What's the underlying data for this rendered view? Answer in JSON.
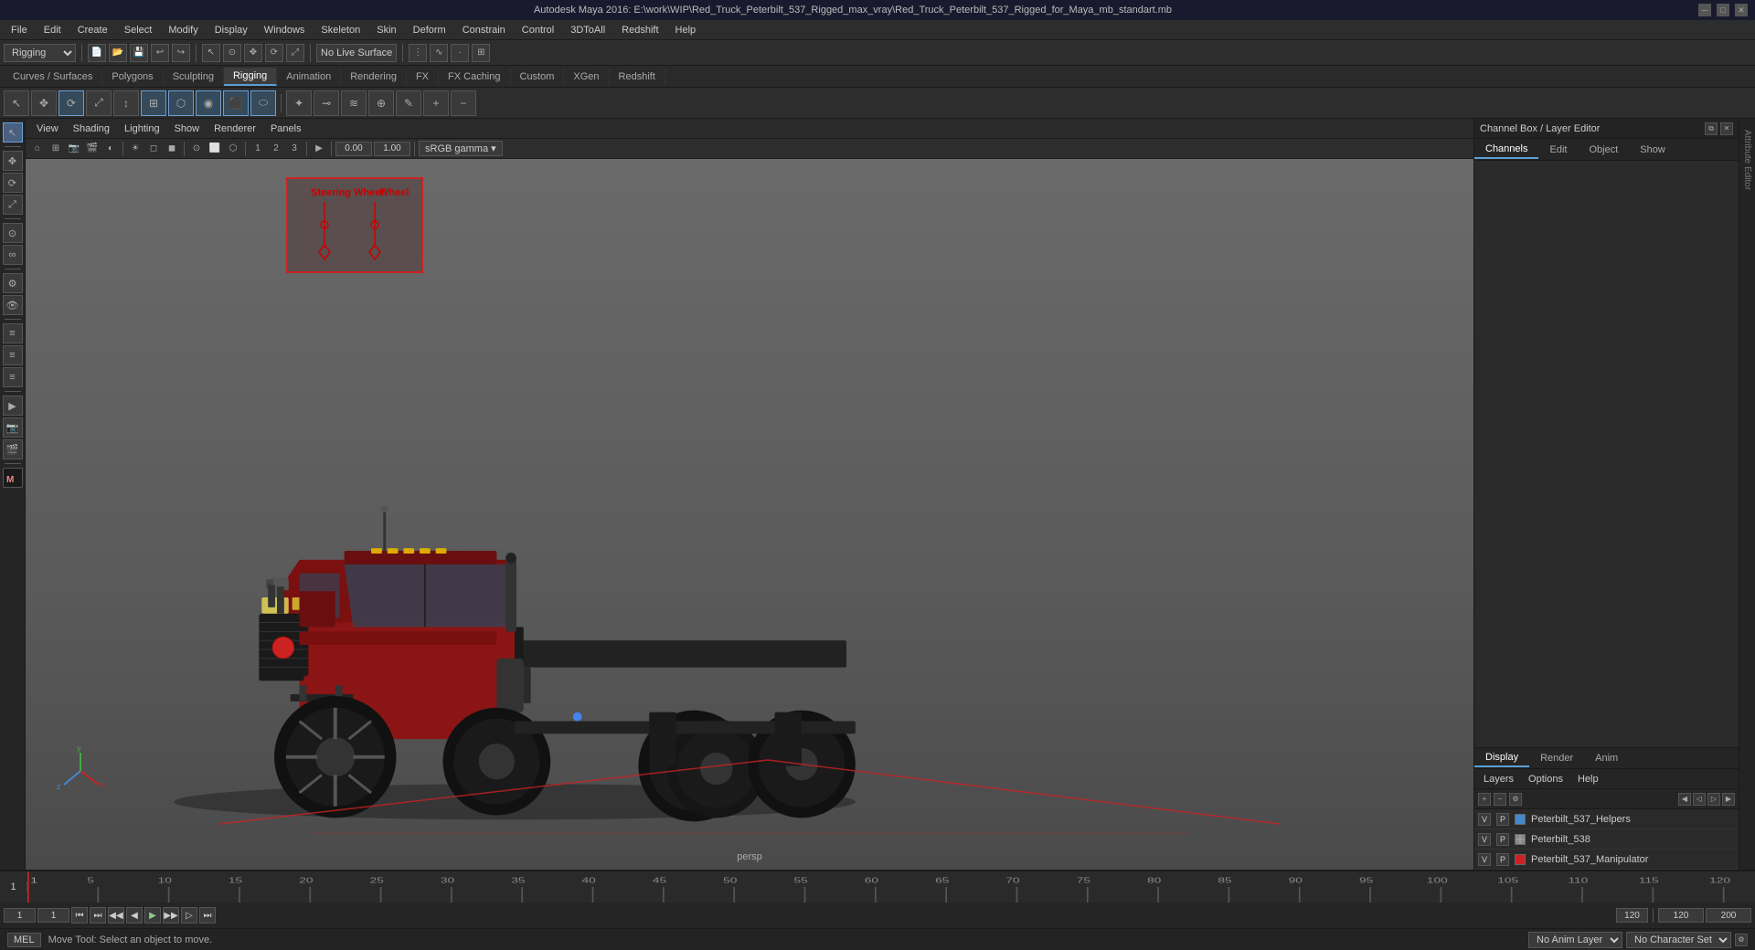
{
  "window": {
    "title": "Autodesk Maya 2016: E:\\work\\WIP\\Red_Truck_Peterbilt_537_Rigged_max_vray\\Red_Truck_Peterbilt_537_Rigged_for_Maya_mb_standart.mb"
  },
  "menubar": {
    "items": [
      "File",
      "Edit",
      "Create",
      "Select",
      "Modify",
      "Display",
      "Windows",
      "Skeleton",
      "Skin",
      "Deform",
      "Constrain",
      "Control",
      "3DToAll",
      "Redshift",
      "Help"
    ]
  },
  "toolbar1": {
    "workspace_dropdown": "Rigging",
    "live_surface_label": "No Live Surface"
  },
  "shelf_tabs": {
    "items": [
      "Curves / Surfaces",
      "Polygons",
      "Sculpting",
      "Rigging",
      "Animation",
      "Rendering",
      "FX",
      "FX Caching",
      "Custom",
      "XGen",
      "Redshift"
    ],
    "active": "Rigging"
  },
  "viewport_menu": {
    "items": [
      "View",
      "Shading",
      "Lighting",
      "Show",
      "Renderer",
      "Panels"
    ]
  },
  "viewport": {
    "camera_label": "persp",
    "color_profile": "sRGB gamma",
    "gamma_value": "0.00",
    "gain_value": "1.00"
  },
  "right_panel": {
    "title": "Channel Box / Layer Editor",
    "tabs": [
      "Channels",
      "Edit",
      "Object",
      "Show"
    ]
  },
  "display_tabs": {
    "items": [
      "Display",
      "Render",
      "Anim"
    ],
    "active": "Display"
  },
  "layers": {
    "menu_items": [
      "Layers",
      "Options",
      "Help"
    ],
    "items": [
      {
        "v": "V",
        "p": "P",
        "color": "#4488cc",
        "name": "Peterbilt_537_Helpers"
      },
      {
        "v": "V",
        "p": "P",
        "color": "#888888",
        "name": "Peterbilt_538"
      },
      {
        "v": "V",
        "p": "P",
        "color": "#cc2222",
        "name": "Peterbilt_537_Manipulator"
      }
    ]
  },
  "timeline": {
    "start_frame": "1",
    "end_frame": "120",
    "current_frame": "1",
    "range_start": "1",
    "range_end": "120",
    "anim_end": "200",
    "ticks": [
      "1",
      "5",
      "10",
      "15",
      "20",
      "25",
      "30",
      "35",
      "40",
      "45",
      "50",
      "55",
      "60",
      "65",
      "70",
      "75",
      "80",
      "85",
      "90",
      "95",
      "100",
      "105",
      "110",
      "115",
      "120"
    ]
  },
  "playback": {
    "buttons": [
      "⏮",
      "⏭",
      "◀◀",
      "◀",
      "▶",
      "▶▶",
      "⏭",
      "⏮"
    ]
  },
  "bottom": {
    "script_type": "MEL",
    "status_message": "Move Tool: Select an object to move.",
    "no_anim_layer": "No Anim Layer",
    "character_set": "No Character Set",
    "anim_end_value": "200"
  },
  "rig_panel": {
    "label1": "Steering",
    "label2": "Wheel",
    "label3": "Wheel"
  },
  "icons": {
    "move": "✥",
    "rotate": "⟳",
    "scale": "⤢",
    "select": "↖",
    "lasso": "⊙",
    "paint": "✎",
    "gear": "⚙",
    "close": "✕",
    "minimize": "─",
    "maximize": "□",
    "layers_icon": "≡",
    "eye_icon": "👁",
    "render_icon": "🎬"
  }
}
